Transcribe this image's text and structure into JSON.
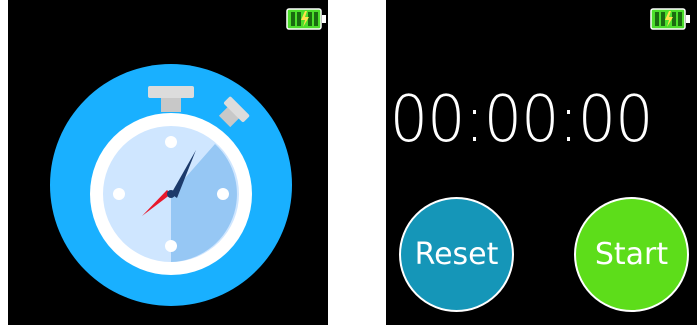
{
  "stopwatch": {
    "display": "00:00:00",
    "reset_label": "Reset",
    "start_label": "Start"
  },
  "colors": {
    "background": "#000000",
    "accent_blue": "#19b0ff",
    "reset_button": "#1596b8",
    "start_button": "#5ddd1a",
    "battery": "#4dde2c",
    "needle_dark": "#1c3a6b",
    "needle_red": "#e8182b"
  },
  "icons": {
    "battery": "battery-full-charging-icon",
    "stopwatch": "stopwatch-icon"
  }
}
